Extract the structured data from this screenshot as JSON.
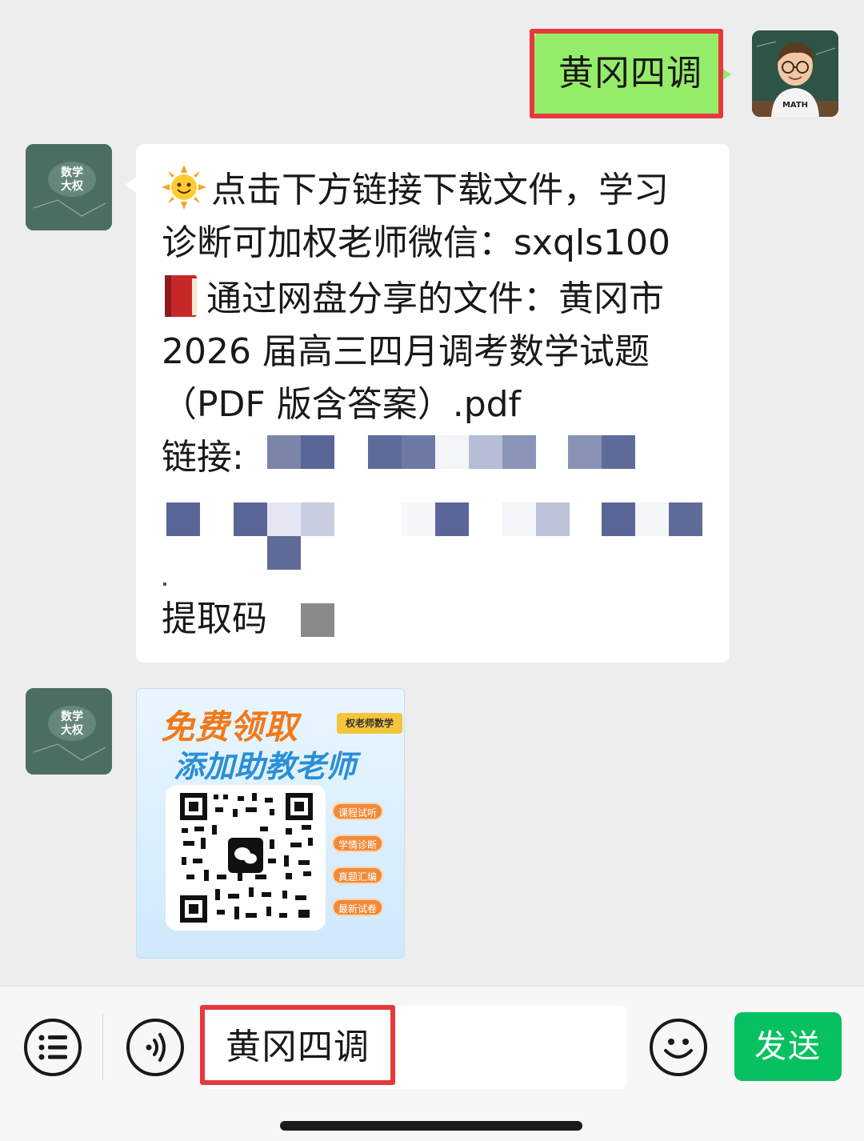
{
  "messages": {
    "outgoing_text": "黄冈四调",
    "incoming": {
      "line1": "点击下方链接下载文件，学习",
      "line2": "诊断可加权老师微信：sxqls100",
      "line3": "通过网盘分享的文件：黄冈市",
      "line4": "2026 届高三四月调考数学试题",
      "line5": "（PDF 版含答案）.pdf",
      "link_label": "链接:",
      "code_label": "提取码"
    },
    "avatar_label": "数学\n大权",
    "teacher_shirt": "MATH"
  },
  "promo": {
    "title": "免费领取",
    "subtitle": "添加助教老师",
    "tag": "权老师数学",
    "pills": [
      "课程试听",
      "学情诊断",
      "真题汇编",
      "最新试卷"
    ]
  },
  "input_bar": {
    "input_value": "黄冈四调",
    "send_label": "发送"
  },
  "colors": {
    "outgoing_bubble": "#95ec69",
    "send_button": "#07c160",
    "highlight": "#e8383d"
  }
}
